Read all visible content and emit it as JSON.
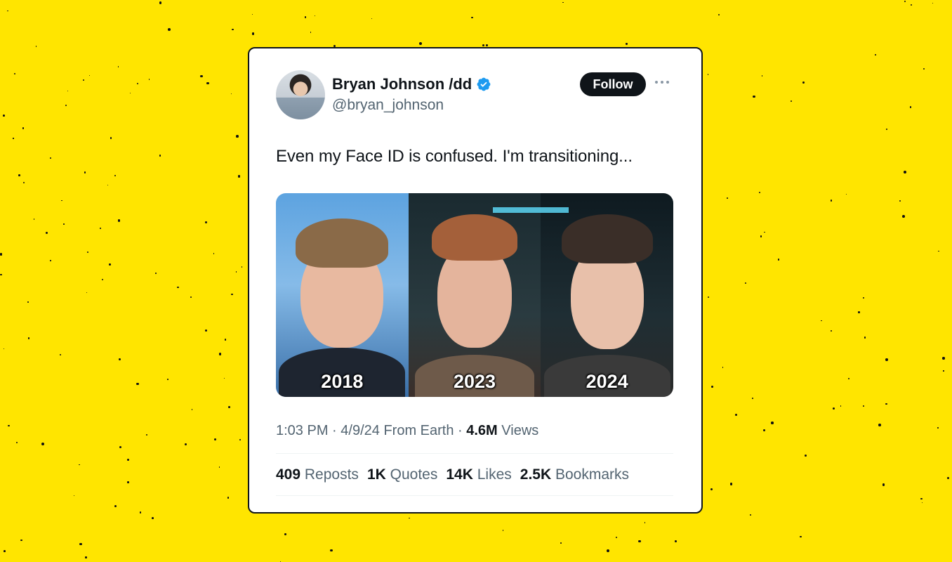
{
  "colors": {
    "background": "#FFE500",
    "card": "#FFFFFF",
    "text": "#0F1419",
    "muted": "#536471",
    "verified": "#1D9BF0"
  },
  "author": {
    "name": "Bryan Johnson /dd",
    "handle": "@bryan_johnson",
    "verified": true,
    "verified_icon": "verified-badge-icon"
  },
  "follow_label": "Follow",
  "more_icon": "more-horizontal-icon",
  "tweet_text": "Even my Face ID is confused. I'm transitioning...",
  "media": {
    "labels": [
      "2018",
      "2023",
      "2024"
    ]
  },
  "meta": {
    "time": "1:03 PM",
    "date": "4/9/24",
    "source": "From Earth",
    "views_count": "4.6M",
    "views_label": "Views"
  },
  "stats": [
    {
      "count": "409",
      "label": "Reposts"
    },
    {
      "count": "1K",
      "label": "Quotes"
    },
    {
      "count": "14K",
      "label": "Likes"
    },
    {
      "count": "2.5K",
      "label": "Bookmarks"
    }
  ]
}
